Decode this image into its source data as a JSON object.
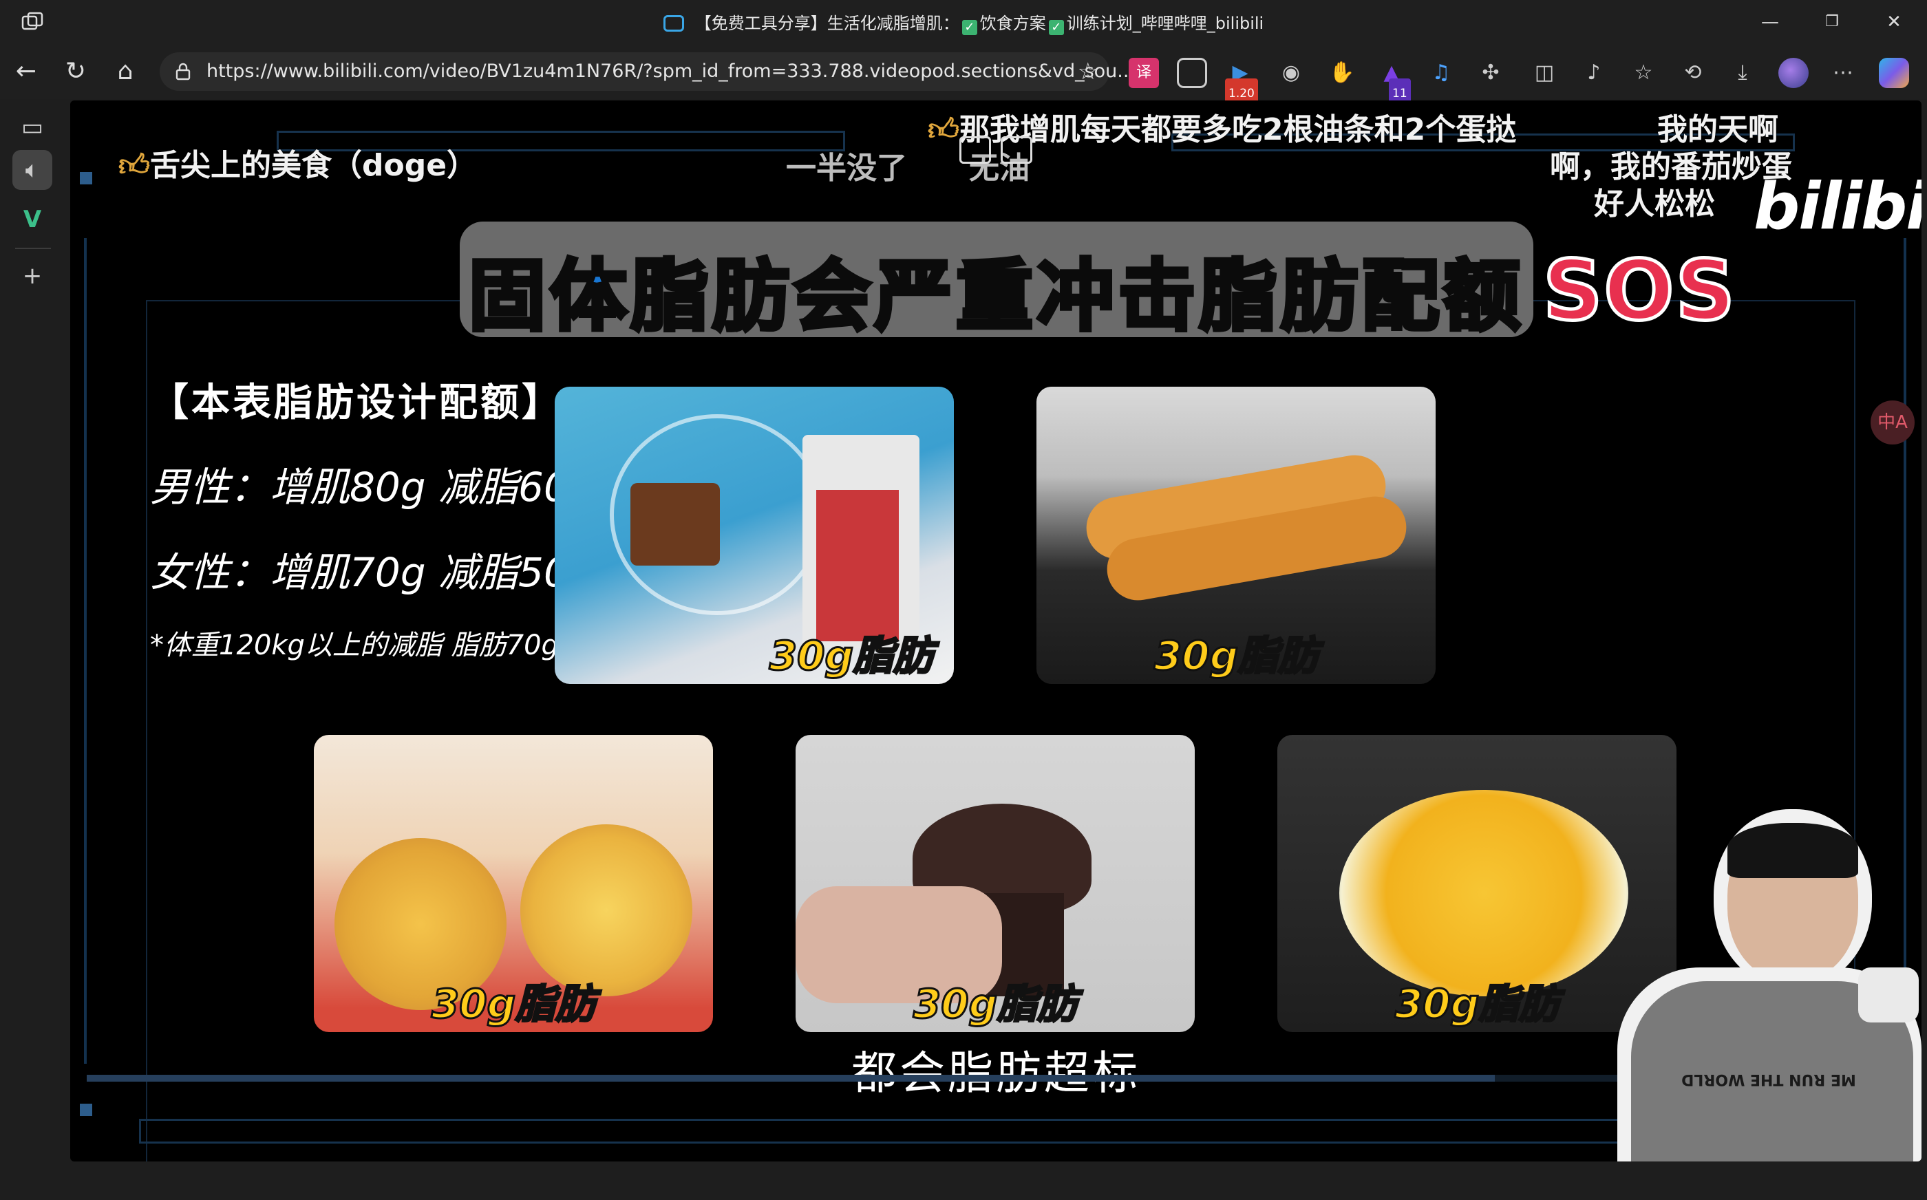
{
  "window": {
    "title": "【免费工具分享】生活化减脂增肌：✅饮食方案 ✅训练计划_哔哩哔哩_bilibili",
    "title_prefix": "【免费工具分享】生活化减脂增肌：",
    "title_part2": "饮食方案",
    "title_part3": "训练计划_哔哩哔哩_bilibili",
    "minimize": "—",
    "restore": "❐",
    "close": "✕"
  },
  "nav": {
    "back": "←",
    "reload": "↻",
    "home": "⌂",
    "url": "https://www.bilibili.com/video/BV1zu4m1N76R/?spm_id_from=333.788.videopod.sections&vd_sou...",
    "favorite": "☆",
    "ext_badge_speed": "1.20",
    "ext_badge_count": "11"
  },
  "colors": {
    "accent_blue": "#1976d2",
    "caption_yellow": "#ffcc1a",
    "sos_red": "#e8304f"
  },
  "video": {
    "headline": "固体脂肪会严重冲击脂肪配额",
    "sos": "SOS",
    "bili_logo": "bilibili",
    "quota_title": "【本表脂肪设计配额】",
    "quota_male": "男性：增肌80g 减脂60g",
    "quota_female": "女性：增肌70g 减脂50g",
    "quota_note": "*体重120kg以上的减脂 脂肪70g",
    "food_caption": "30g脂肪",
    "subtitle": "都会脂肪超标",
    "translate_label": "中A",
    "progress": 0.775
  },
  "danmaku": {
    "d1": "舌尖上的美食（doge）",
    "d2": "一半没了",
    "d3": "那我增肌每天都要多吃2根油条和2个蛋挞",
    "d4": "我的天啊",
    "d5": "啊，我的番茄炒蛋",
    "d6": "好人松松",
    "d7": "无油"
  },
  "shirt_text": "ME RUN THE WORLD"
}
